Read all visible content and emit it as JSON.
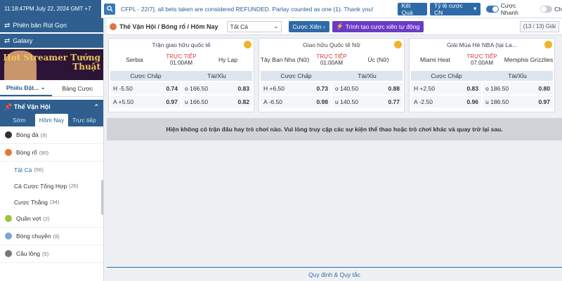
{
  "topbar": {
    "datetime": "11:18:47PM July 22, 2024 GMT +7",
    "ticker": "CFPL - 22/7], all bets taken are considered REFUNDED. Parlay counted as one (1). Thank you!",
    "result_btn": "Kết Quả",
    "odds_type": "Tỷ lệ cược CN",
    "quick_bet": "Cược Nhanh",
    "other_toggle": "Ch"
  },
  "sidebar": {
    "promo1": "Phiên bản Rút Gọn",
    "promo2": "Galaxy",
    "banner_text": "Hot Streamer Tướng Thuật",
    "subtab_left": "Phiếu Đặt...",
    "subtab_right": "Bảng Cược",
    "section": "Thể Vận Hội",
    "time_tabs": [
      "Sớm",
      "Hôm Nay",
      "Trực tiếp"
    ],
    "sports": [
      {
        "label": "Bóng đá",
        "count": "(9)",
        "color": "#333333"
      },
      {
        "label": "Bóng rổ",
        "count": "(90)",
        "color": "#e0783a"
      }
    ],
    "subs": [
      {
        "label": "Tất Cả",
        "count": "(56)"
      },
      {
        "label": "Cả Cược Tổng Hợp",
        "count": "(26)"
      },
      {
        "label": "Cược Thắng",
        "count": "(34)"
      }
    ],
    "sports2": [
      {
        "label": "Quần vợt",
        "count": "(2)",
        "color": "#9bc53d"
      },
      {
        "label": "Bóng chuyền",
        "count": "(8)",
        "color": "#7aa6d6"
      },
      {
        "label": "Cầu lông",
        "count": "(5)",
        "color": "#777777"
      }
    ]
  },
  "main": {
    "title": "Thế Vận Hội / Bóng rổ / Hôm Nay",
    "select_value": "Tất Cả",
    "parlay_btn": "Cược Xiên",
    "create_btn": "Trình tạo cược xiên tự động",
    "count": "(13 / 13) Giải",
    "odds_labels": [
      "Cược Chấp",
      "Tài/Xỉu"
    ],
    "notice": "Hiện không có trận đấu hay trò chơi nào. Vui lòng truy cập các sự kiện thể thao hoặc trò chơi khác và quay trở lại sau.",
    "footer": "Quy định & Quy tắc",
    "cards": [
      {
        "league": "Trận giao hữu quốc tế",
        "home": "Serbia",
        "away": "Hy Lạp",
        "live": "TRỰC TIẾP",
        "time": "01:00AM",
        "h_hdp": "H -5.50",
        "h_hdp_v": "0.74",
        "h_ou": "o 166.50",
        "h_ou_v": "0.83",
        "a_hdp": "A +5.50",
        "a_hdp_v": "0.97",
        "a_ou": "u 166.50",
        "a_ou_v": "0.82"
      },
      {
        "league": "Giao hữu Quốc tế Nữ",
        "home": "Tây Ban Nha (Nữ)",
        "away": "Úc (Nữ)",
        "live": "TRỰC TIẾP",
        "time": "01:00AM",
        "h_hdp": "H +6.50",
        "h_hdp_v": "0.73",
        "h_ou": "o 140.50",
        "h_ou_v": "0.88",
        "a_hdp": "A -6.50",
        "a_hdp_v": "0.98",
        "a_ou": "u 140.50",
        "a_ou_v": "0.77"
      },
      {
        "league": "Giải Mùa Hè NBA (tại La...",
        "home": "Miami Heat",
        "away": "Memphis Grizzlies",
        "live": "TRỰC TIẾP",
        "time": "07:00AM",
        "h_hdp": "H +2.50",
        "h_hdp_v": "0.83",
        "h_ou": "o 186.50",
        "h_ou_v": "0.80",
        "a_hdp": "A -2.50",
        "a_hdp_v": "0.96",
        "a_ou": "u 186.50",
        "a_ou_v": "0.97"
      }
    ]
  }
}
